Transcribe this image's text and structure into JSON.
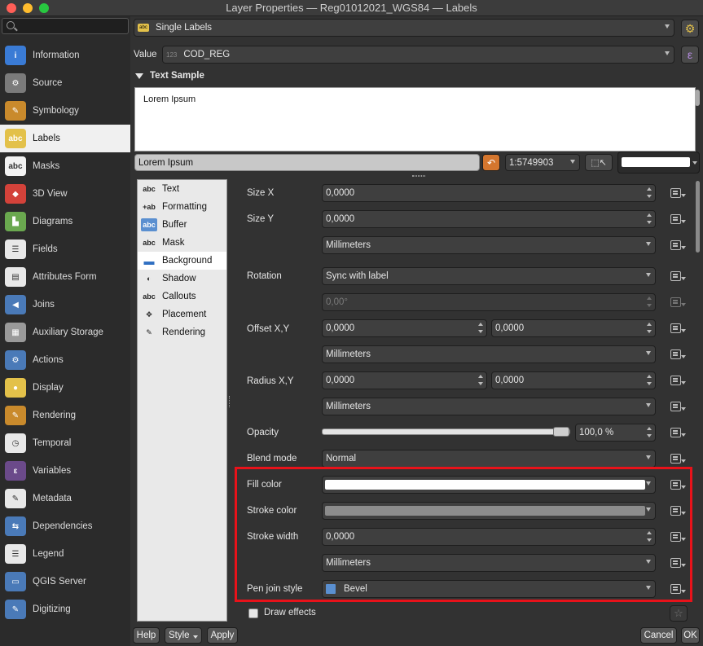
{
  "window": {
    "title": "Layer Properties — Reg01012021_WGS84 — Labels"
  },
  "sidebar": {
    "items": [
      {
        "label": "Information",
        "icon": "info-icon",
        "color": "#3a7bd5",
        "glyph": "i"
      },
      {
        "label": "Source",
        "icon": "wrench-icon",
        "color": "#7b7b7b",
        "glyph": "⚙"
      },
      {
        "label": "Symbology",
        "icon": "paintbrush-icon",
        "color": "#c98a2c",
        "glyph": "✎"
      },
      {
        "label": "Labels",
        "icon": "abc-label-icon",
        "color": "#e3c14a",
        "glyph": "abc"
      },
      {
        "label": "Masks",
        "icon": "abc-mask-icon",
        "color": "#f2f2f2",
        "glyph": "abc"
      },
      {
        "label": "3D View",
        "icon": "cube-icon",
        "color": "#d3423a",
        "glyph": "◆"
      },
      {
        "label": "Diagrams",
        "icon": "diagram-icon",
        "color": "#6aa84f",
        "glyph": "▙"
      },
      {
        "label": "Fields",
        "icon": "fields-icon",
        "color": "#e8e8e8",
        "glyph": "☰"
      },
      {
        "label": "Attributes Form",
        "icon": "form-icon",
        "color": "#e8e8e8",
        "glyph": "▤"
      },
      {
        "label": "Joins",
        "icon": "joins-icon",
        "color": "#4a7ab8",
        "glyph": "◀"
      },
      {
        "label": "Auxiliary Storage",
        "icon": "database-icon",
        "color": "#9a9a9a",
        "glyph": "▦"
      },
      {
        "label": "Actions",
        "icon": "gear-icon",
        "color": "#4a7ab8",
        "glyph": "⚙"
      },
      {
        "label": "Display",
        "icon": "speech-bubble-icon",
        "color": "#e3c14a",
        "glyph": "●"
      },
      {
        "label": "Rendering",
        "icon": "paintbrush-icon",
        "color": "#c98a2c",
        "glyph": "✎"
      },
      {
        "label": "Temporal",
        "icon": "clock-icon",
        "color": "#e8e8e8",
        "glyph": "◷"
      },
      {
        "label": "Variables",
        "icon": "epsilon-icon",
        "color": "#6b4a8a",
        "glyph": "ε"
      },
      {
        "label": "Metadata",
        "icon": "document-icon",
        "color": "#e8e8e8",
        "glyph": "✎"
      },
      {
        "label": "Dependencies",
        "icon": "dependencies-icon",
        "color": "#4a7ab8",
        "glyph": "⇆"
      },
      {
        "label": "Legend",
        "icon": "legend-icon",
        "color": "#e8e8e8",
        "glyph": "☰"
      },
      {
        "label": "QGIS Server",
        "icon": "server-icon",
        "color": "#4a7ab8",
        "glyph": "▭"
      },
      {
        "label": "Digitizing",
        "icon": "digitizing-icon",
        "color": "#4a7ab8",
        "glyph": "✎"
      }
    ],
    "active_index": 3
  },
  "top": {
    "mode": "Single Labels",
    "value_label": "Value",
    "value_field": "COD_REG",
    "value_prefix": "123"
  },
  "text_sample": {
    "header": "Text Sample",
    "preview": "Lorem Ipsum",
    "input_value": "Lorem Ipsum",
    "scale": "1:5749903"
  },
  "tabs": [
    {
      "label": "Text",
      "icon": "text-abc-icon",
      "glyph": "abc"
    },
    {
      "label": "Formatting",
      "icon": "formatting-icon",
      "glyph": "+ab"
    },
    {
      "label": "Buffer",
      "icon": "buffer-icon",
      "glyph": "abc"
    },
    {
      "label": "Mask",
      "icon": "mask-icon",
      "glyph": "abc"
    },
    {
      "label": "Background",
      "icon": "background-icon",
      "glyph": "▬"
    },
    {
      "label": "Shadow",
      "icon": "shadow-icon",
      "glyph": "◐"
    },
    {
      "label": "Callouts",
      "icon": "callouts-icon",
      "glyph": "abc"
    },
    {
      "label": "Placement",
      "icon": "placement-icon",
      "glyph": "✥"
    },
    {
      "label": "Rendering",
      "icon": "rendering-icon",
      "glyph": "✎"
    }
  ],
  "form": {
    "size_x": {
      "label": "Size X",
      "value": "0,0000"
    },
    "size_y": {
      "label": "Size Y",
      "value": "0,0000"
    },
    "size_unit": "Millimeters",
    "rotation": {
      "label": "Rotation",
      "mode": "Sync with label",
      "value": "0,00°"
    },
    "offset": {
      "label": "Offset X,Y",
      "x": "0,0000",
      "y": "0,0000",
      "unit": "Millimeters"
    },
    "radius": {
      "label": "Radius X,Y",
      "x": "0,0000",
      "y": "0,0000",
      "unit": "Millimeters"
    },
    "opacity": {
      "label": "Opacity",
      "value": "100,0 %",
      "level": 1.0
    },
    "blend": {
      "label": "Blend mode",
      "value": "Normal"
    },
    "fill": {
      "label": "Fill color",
      "color": "#ffffff"
    },
    "stroke": {
      "label": "Stroke color",
      "color": "#8c8c8c"
    },
    "stroke_width": {
      "label": "Stroke width",
      "value": "0,0000",
      "unit": "Millimeters"
    },
    "pen_join": {
      "label": "Pen join style",
      "value": "Bevel"
    },
    "draw_effects": {
      "label": "Draw effects",
      "checked": false
    }
  },
  "buttons": {
    "help": "Help",
    "style": "Style",
    "apply": "Apply",
    "cancel": "Cancel",
    "ok": "OK"
  }
}
